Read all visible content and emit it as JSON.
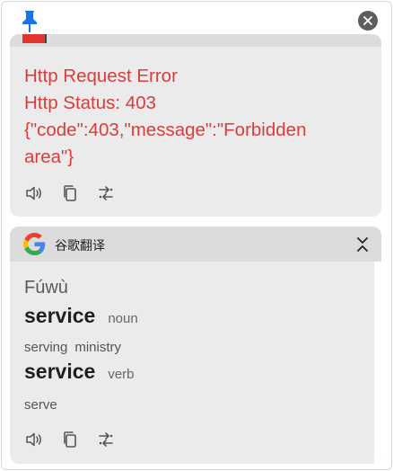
{
  "icons": {
    "pin": "pin-icon",
    "close": "close-icon",
    "speaker": "speaker-icon",
    "copy": "copy-icon",
    "swap": "swap-icon",
    "google": "google-logo",
    "collapse": "collapse-icon"
  },
  "colors": {
    "error": "#dc3b3b",
    "pin": "#1a73e8",
    "card_bg": "#ebebeb",
    "header_bg": "#dcdcdc"
  },
  "error_card": {
    "lines": [
      "Http Request Error",
      "Http Status: 403",
      "{\"code\":403,\"message\":\"Forbidden",
      "area\"}"
    ]
  },
  "google_card": {
    "service_name": "谷歌翻译",
    "pinyin": "Fúwù",
    "entries": [
      {
        "word": "service",
        "pos": "noun",
        "synonyms": [
          "serving",
          "ministry"
        ]
      },
      {
        "word": "service",
        "pos": "verb",
        "synonyms": [
          "serve"
        ]
      }
    ]
  }
}
